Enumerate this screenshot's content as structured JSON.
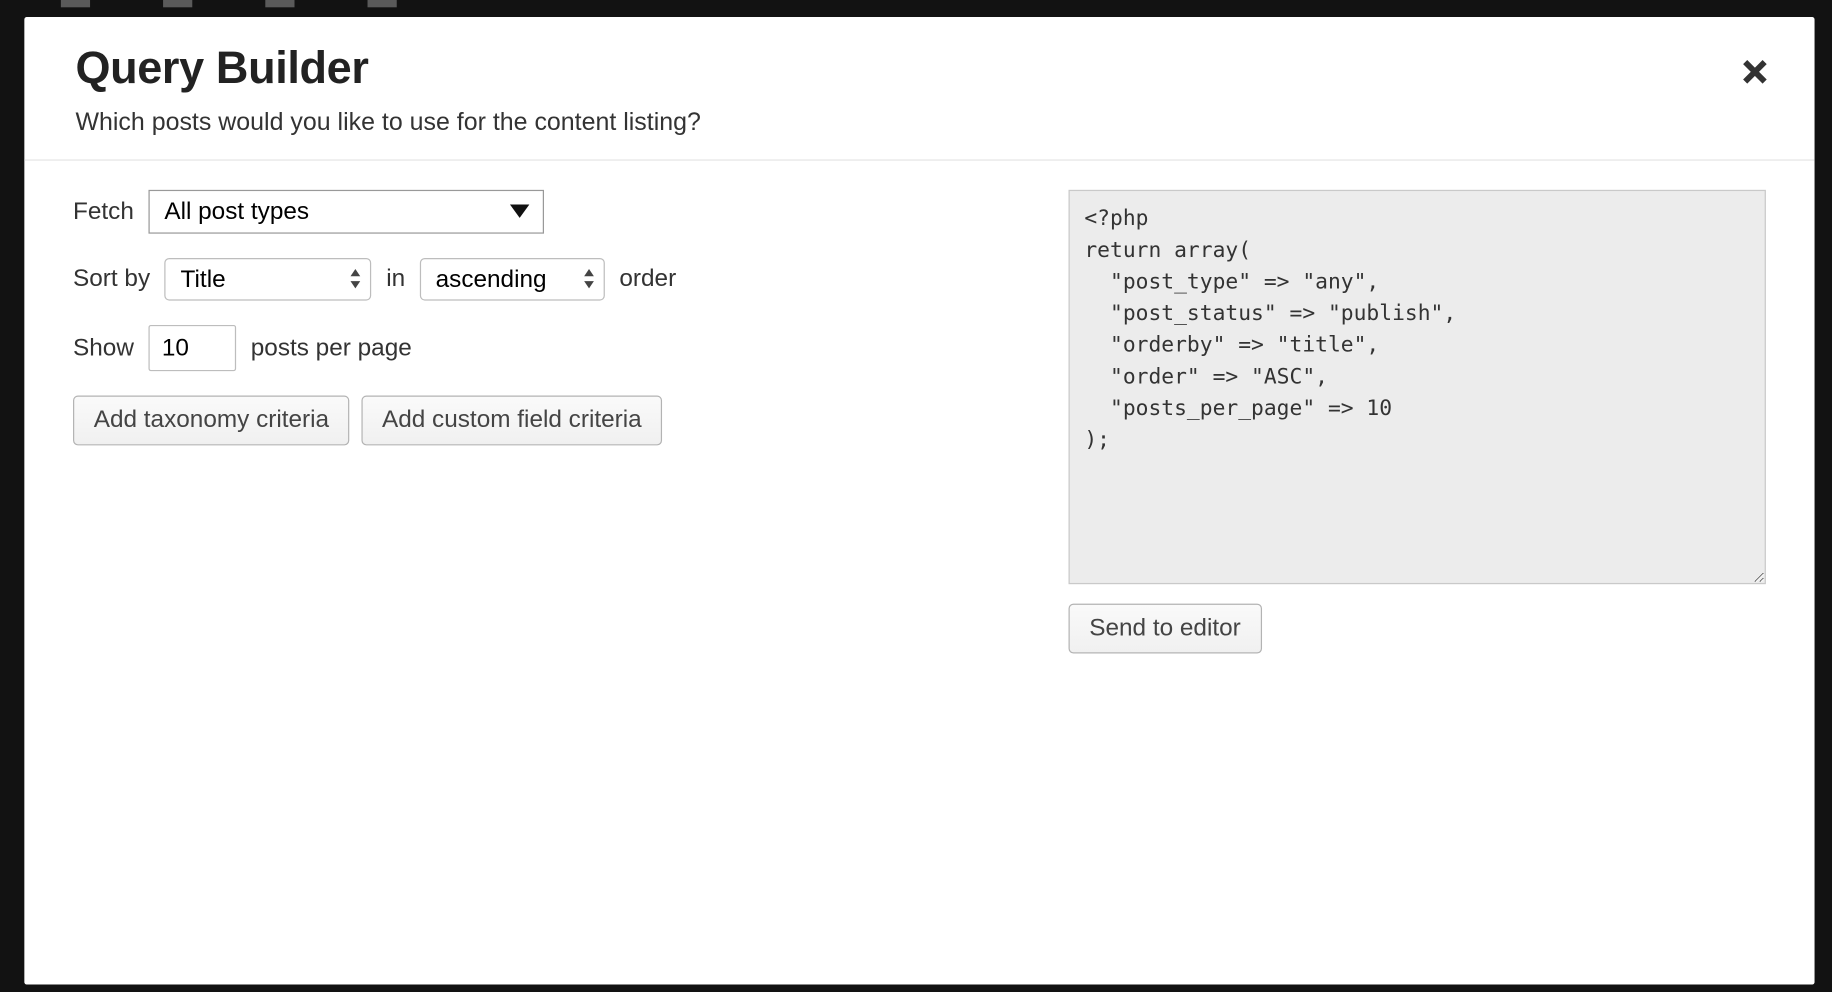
{
  "header": {
    "title": "Query Builder",
    "subtitle": "Which posts would you like to use for the content listing?",
    "close_icon": "✕"
  },
  "form": {
    "fetch_label": "Fetch",
    "fetch_value": "All post types",
    "sortby_label": "Sort by",
    "sortby_value": "Title",
    "in_word": "in",
    "direction_value": "ascending",
    "order_word": "order",
    "show_label": "Show",
    "show_value": "10",
    "pp_label": "posts per page",
    "add_taxonomy_label": "Add taxonomy criteria",
    "add_customfield_label": "Add custom field criteria"
  },
  "codeview": {
    "content": "<?php\nreturn array(\n  \"post_type\" => \"any\",\n  \"post_status\" => \"publish\",\n  \"orderby\" => \"title\",\n  \"order\" => \"ASC\",\n  \"posts_per_page\" => 10\n);",
    "send_label": "Send to editor"
  }
}
